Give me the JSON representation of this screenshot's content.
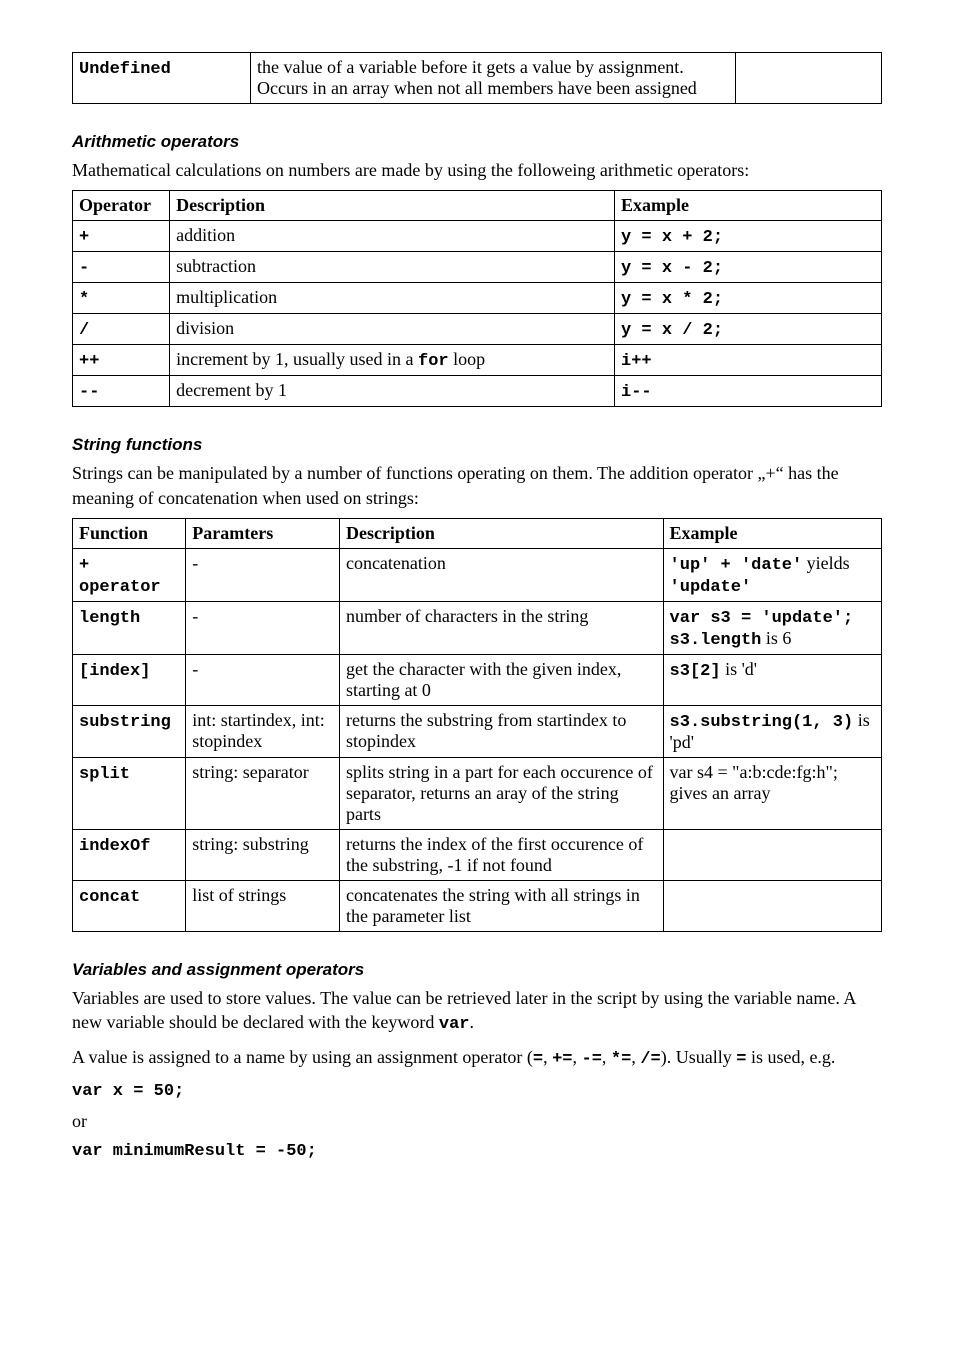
{
  "undef_table": {
    "rows": [
      {
        "name": "Undefined",
        "desc": "the value of a variable before it gets a value by assignment. Occurs in an array when not all members have been assigned",
        "col3": ""
      }
    ]
  },
  "arith": {
    "heading": "Arithmetic operators",
    "intro": "Mathematical calculations on numbers are made by using the followeing arithmetic operators:",
    "head": {
      "op": "Operator",
      "desc": "Description",
      "ex": "Example"
    },
    "rows": [
      {
        "op": "+",
        "desc": "addition",
        "ex": "y = x + 2;"
      },
      {
        "op": "-",
        "desc": "subtraction",
        "ex": "y = x - 2;"
      },
      {
        "op": "*",
        "desc": "multiplication",
        "ex": "y = x * 2;"
      },
      {
        "op": "/",
        "desc": "division",
        "ex": "y = x / 2;"
      },
      {
        "op": "++",
        "desc_pre": "increment by 1, usually used in a ",
        "desc_code": "for",
        "desc_post": " loop",
        "ex": "i++"
      },
      {
        "op": "--",
        "desc": "decrement by 1",
        "ex": "i--"
      }
    ]
  },
  "strfn": {
    "heading": "String functions",
    "intro_pre": "Strings can be manipulated by a number of functions operating on them. The addition operator „+“ has the meaning of concatenation when used on strings:",
    "head": {
      "fn": "Function",
      "params": "Paramters",
      "desc": "Description",
      "ex": "Example"
    },
    "rows": [
      {
        "fn": "+ operator",
        "params": "-",
        "desc": "concatenation",
        "ex_code1": "'up' + 'date'",
        "ex_mid": " yields ",
        "ex_code2": "'update'"
      },
      {
        "fn": "length",
        "params": "-",
        "desc": "number of characters in the string",
        "ex_code1": "var s3 = 'update';",
        "ex_br": true,
        "ex_code2": "s3.length",
        "ex_post": " is 6"
      },
      {
        "fn": "[index]",
        "params": "-",
        "desc": "get the character with the given index, starting at 0",
        "ex_code1": "s3[2]",
        "ex_post": " is 'd'"
      },
      {
        "fn": "substring",
        "params": "int: startindex, int: stopindex",
        "desc": "returns the substring from startindex to stopindex",
        "ex_code1": "s3.substring(1, 3)",
        "ex_post": " is 'pd'"
      },
      {
        "fn": "split",
        "params": "string: separator",
        "desc": "splits string in a part for each occurence of separator, returns an aray of the string parts",
        "ex_plain": "var s4 = \"a:b:cde:fg:h\"; gives an array"
      },
      {
        "fn": "indexOf",
        "params": "string: substring",
        "desc": "returns the index of the first occurence of the substring, -1 if not found",
        "ex_plain": ""
      },
      {
        "fn": "concat",
        "params": "list of strings",
        "desc": "concatenates the string with all strings in the parameter list",
        "ex_plain": ""
      }
    ]
  },
  "vars": {
    "heading": "Variables and assignment operators",
    "p1_pre": "Variables are used to store values. The value can be retrieved later in the script by using the variable name. A new variable should be declared with the keyword ",
    "p1_code": "var",
    "p1_post": ".",
    "p2_pre": "A value is assigned to a name by using an assignment operator (",
    "ops": [
      "=",
      "+=",
      "-=",
      "*=",
      "/="
    ],
    "p2_mid": "). Usually ",
    "p2_eq": "=",
    "p2_post": " is used, e.g.",
    "code1": "var x = 50;",
    "or": "or",
    "code2": "var minimumResult = -50;"
  }
}
